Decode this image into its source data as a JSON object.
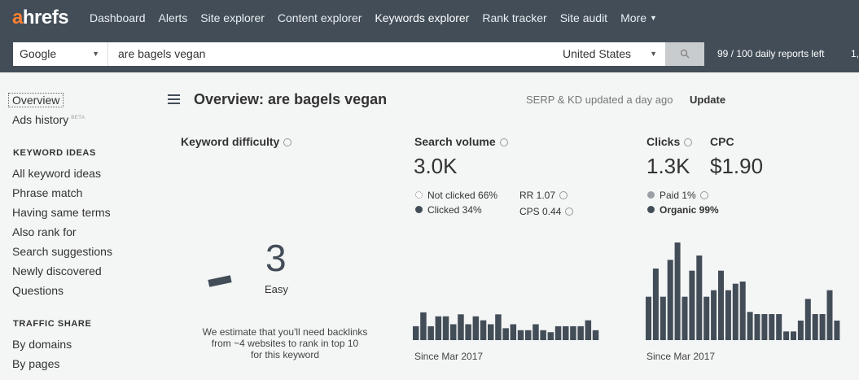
{
  "nav": {
    "logo_a": "a",
    "logo_rest": "hrefs",
    "items": [
      "Dashboard",
      "Alerts",
      "Site explorer",
      "Content explorer",
      "Keywords explorer",
      "Rank tracker",
      "Site audit",
      "More"
    ],
    "active_index": 4
  },
  "search": {
    "engine": "Google",
    "query": "are bagels vegan",
    "country": "United States",
    "reports_left": "99 / 100 daily reports left",
    "reports_extra": "1,"
  },
  "sidebar": {
    "overview": "Overview",
    "ads_history": "Ads history",
    "beta": "BETA",
    "keyword_ideas_head": "KEYWORD IDEAS",
    "keyword_ideas": [
      "All keyword ideas",
      "Phrase match",
      "Having same terms",
      "Also rank for",
      "Search suggestions",
      "Newly discovered",
      "Questions"
    ],
    "traffic_share_head": "TRAFFIC SHARE",
    "traffic_share": [
      "By domains",
      "By pages"
    ]
  },
  "overview": {
    "title": "Overview: are bagels vegan",
    "updated": "SERP & KD updated a day ago",
    "update_link": "Update"
  },
  "kd": {
    "label": "Keyword difficulty",
    "value": "3",
    "level": "Easy",
    "level_value": 3,
    "description_lines": [
      "We estimate that you'll need backlinks",
      "from ~4 websites to rank in top 10",
      "for this keyword"
    ]
  },
  "search_volume": {
    "label": "Search volume",
    "value": "3.0K",
    "not_clicked": "Not clicked 66%",
    "clicked": "Clicked 34%",
    "rr": "RR 1.07",
    "cps": "CPS 0.44",
    "since": "Since Mar 2017"
  },
  "clicks": {
    "label": "Clicks",
    "value": "1.3K",
    "paid": "Paid 1%",
    "organic": "Organic 99%",
    "since": "Since Mar 2017"
  },
  "cpc": {
    "label": "CPC",
    "value": "$1.90"
  },
  "colors": {
    "nav_bg": "#424d58",
    "accent": "#ff7f32",
    "bar": "#424d58",
    "page_bg": "#f4f5f5"
  },
  "chart_data": [
    {
      "type": "bar",
      "name": "Search volume history",
      "values": [
        7,
        14,
        7,
        12,
        12,
        8,
        13,
        8,
        12,
        10,
        8,
        13,
        6,
        8,
        5,
        5,
        8,
        5,
        4,
        7,
        7,
        7,
        7,
        10,
        5
      ],
      "ylim": [
        0,
        32
      ]
    },
    {
      "type": "bar",
      "name": "Clicks history",
      "values": [
        20,
        33,
        20,
        37,
        45,
        20,
        32,
        39,
        20,
        23,
        32,
        23,
        26,
        27,
        13,
        12,
        12,
        12,
        12,
        4,
        4,
        9,
        19,
        12,
        12,
        23,
        9
      ]
    }
  ]
}
